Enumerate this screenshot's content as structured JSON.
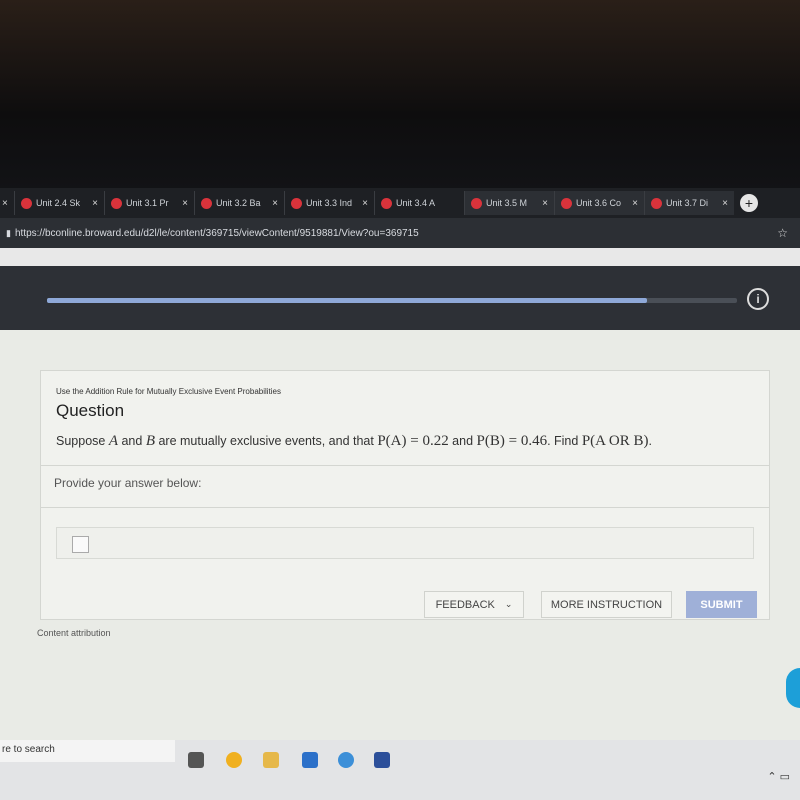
{
  "browser": {
    "tabs": [
      {
        "label": "Unit 2.4 Sk"
      },
      {
        "label": "Unit 3.1 Pr"
      },
      {
        "label": "Unit 3.2 Ba"
      },
      {
        "label": "Unit 3.3 Ind"
      },
      {
        "label": "Unit 3.4 A"
      },
      {
        "label": "Unit 3.5 M"
      },
      {
        "label": "Unit 3.6 Co"
      },
      {
        "label": "Unit 3.7 Di"
      }
    ],
    "close_glyph": "×",
    "new_tab": "+",
    "url": "https://bconline.broward.edu/d2l/le/content/369715/viewContent/9519881/View?ou=369715",
    "star": "☆"
  },
  "header": {
    "progress_percent": 87,
    "info": "i"
  },
  "question": {
    "topic": "Use the Addition Rule for Mutually Exclusive Event Probabilities",
    "title": "Question",
    "text_parts": [
      "Suppose ",
      "A",
      " and ",
      "B",
      " are mutually exclusive events, and that ",
      "P(A) = 0.22",
      " and ",
      "P(B) = 0.46",
      ". Find ",
      "P(A OR B)",
      "."
    ],
    "prompt": "Provide your answer below:",
    "answer_value": ""
  },
  "buttons": {
    "feedback": "FEEDBACK",
    "more_instruction": "MORE INSTRUCTION",
    "submit": "SUBMIT"
  },
  "content_attribution": "Content attribution",
  "taskbar": {
    "search_placeholder": "re to search"
  },
  "colors": {
    "accent": "#9fb0d8",
    "progress": "#8ea8d8",
    "favicon": "#d9333b"
  }
}
